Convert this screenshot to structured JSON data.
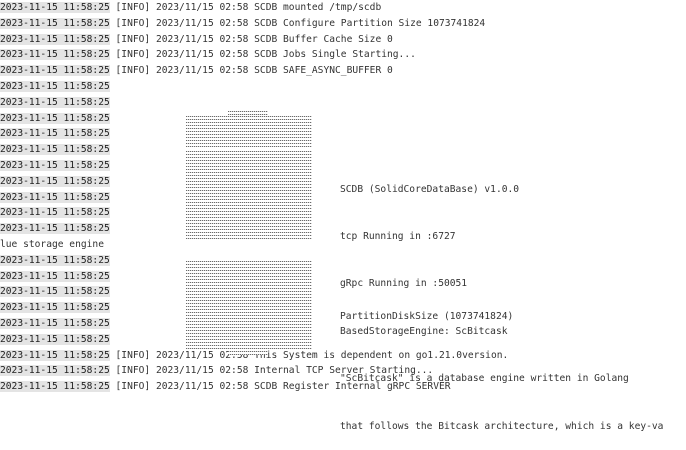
{
  "log": [
    {
      "ts": "2023-11-15 11:58:25",
      "msg": " [INFO] 2023/11/15 02:58 SCDB mounted /tmp/scdb"
    },
    {
      "ts": "2023-11-15 11:58:25",
      "msg": " [INFO] 2023/11/15 02:58 SCDB Configure Partition Size 1073741824"
    },
    {
      "ts": "2023-11-15 11:58:25",
      "msg": " [INFO] 2023/11/15 02:58 SCDB Buffer Cache Size 0"
    },
    {
      "ts": "2023-11-15 11:58:25",
      "msg": " [INFO] 2023/11/15 02:58 SCDB Jobs Single Starting..."
    },
    {
      "ts": "2023-11-15 11:58:25",
      "msg": " [INFO] 2023/11/15 02:58 SCDB SAFE_ASYNC_BUFFER 0"
    },
    {
      "ts": "2023-11-15 11:58:25",
      "msg": ""
    },
    {
      "ts": "2023-11-15 11:58:25",
      "msg": ""
    },
    {
      "ts": "2023-11-15 11:58:25",
      "msg": ""
    },
    {
      "ts": "2023-11-15 11:58:25",
      "msg": ""
    },
    {
      "ts": "2023-11-15 11:58:25",
      "msg": ""
    },
    {
      "ts": "2023-11-15 11:58:25",
      "msg": ""
    },
    {
      "ts": "2023-11-15 11:58:25",
      "msg": ""
    },
    {
      "ts": "2023-11-15 11:58:25",
      "msg": ""
    },
    {
      "ts": "2023-11-15 11:58:25",
      "msg": ""
    },
    {
      "ts": "2023-11-15 11:58:25",
      "msg": ""
    },
    {
      "ts": "",
      "msg": "lue storage engine"
    },
    {
      "ts": "2023-11-15 11:58:25",
      "msg": ""
    },
    {
      "ts": "2023-11-15 11:58:25",
      "msg": ""
    },
    {
      "ts": "2023-11-15 11:58:25",
      "msg": ""
    },
    {
      "ts": "2023-11-15 11:58:25",
      "msg": ""
    },
    {
      "ts": "2023-11-15 11:58:25",
      "msg": ""
    },
    {
      "ts": "2023-11-15 11:58:25",
      "msg": ""
    },
    {
      "ts": "2023-11-15 11:58:25",
      "msg": " [INFO] 2023/11/15 02:58 This System is dependent on go1.21.0version."
    },
    {
      "ts": "2023-11-15 11:58:25",
      "msg": " [INFO] 2023/11/15 02:58 Internal TCP Server Starting..."
    },
    {
      "ts": "2023-11-15 11:58:25",
      "msg": " [INFO] 2023/11/15 02:58 SCDB Register Internal gRPC SERVER"
    }
  ],
  "banner": {
    "info1": [
      "SCDB (SolidCoreDataBase) v1.0.0",
      "tcp Running in :6727",
      "gRpc Running in :50051",
      "BasedStorageEngine: ScBitcask",
      "\"ScBitcask\" is a database engine written in Golang",
      "that follows the Bitcask architecture, which is a key-va"
    ],
    "info2": "PartitionDiskSize (1073741824)"
  }
}
